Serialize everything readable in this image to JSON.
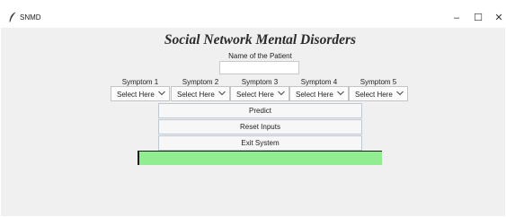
{
  "window": {
    "title": "SNMD",
    "icon": "feather-icon",
    "controls": {
      "minimize": "–",
      "maximize": "☐",
      "close": "✕"
    }
  },
  "main": {
    "heading": "Social Network Mental Disorders",
    "patient_label": "Name of the Patient",
    "patient_value": "",
    "symptoms": [
      {
        "label": "Symptom 1",
        "value": "Select Here"
      },
      {
        "label": "Symptom 2",
        "value": "Select Here"
      },
      {
        "label": "Symptom 3",
        "value": "Select Here"
      },
      {
        "label": "Symptom 4",
        "value": "Select Here"
      },
      {
        "label": "Symptom 5",
        "value": "Select Here"
      }
    ],
    "buttons": {
      "predict": "Predict",
      "reset": "Reset Inputs",
      "exit": "Exit System"
    },
    "result_text": "",
    "result_color": "#90ee90"
  }
}
